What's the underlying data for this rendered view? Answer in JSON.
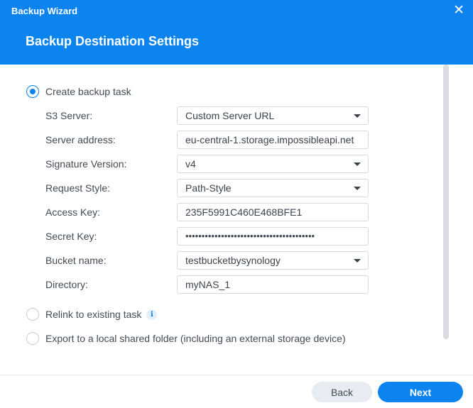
{
  "window": {
    "title": "Backup Wizard"
  },
  "header": {
    "step_title": "Backup Destination Settings"
  },
  "options": {
    "create": "Create backup task",
    "relink": "Relink to existing task",
    "export": "Export to a local shared folder (including an external storage device)"
  },
  "form": {
    "s3_server": {
      "label": "S3 Server:",
      "value": "Custom Server URL"
    },
    "server_address": {
      "label": "Server address:",
      "value": "eu-central-1.storage.impossibleapi.net"
    },
    "signature_version": {
      "label": "Signature Version:",
      "value": "v4"
    },
    "request_style": {
      "label": "Request Style:",
      "value": "Path-Style"
    },
    "access_key": {
      "label": "Access Key:",
      "value": "235F5991C460E468BFE1"
    },
    "secret_key": {
      "label": "Secret Key:",
      "value": "••••••••••••••••••••••••••••••••••••••••"
    },
    "bucket_name": {
      "label": "Bucket name:",
      "value": "testbucketbysynology"
    },
    "directory": {
      "label": "Directory:",
      "value": "myNAS_1"
    }
  },
  "footer": {
    "back": "Back",
    "next": "Next"
  },
  "colors": {
    "accent": "#0b84f0"
  },
  "icons": {
    "close": "close-icon",
    "info": "info-icon"
  }
}
